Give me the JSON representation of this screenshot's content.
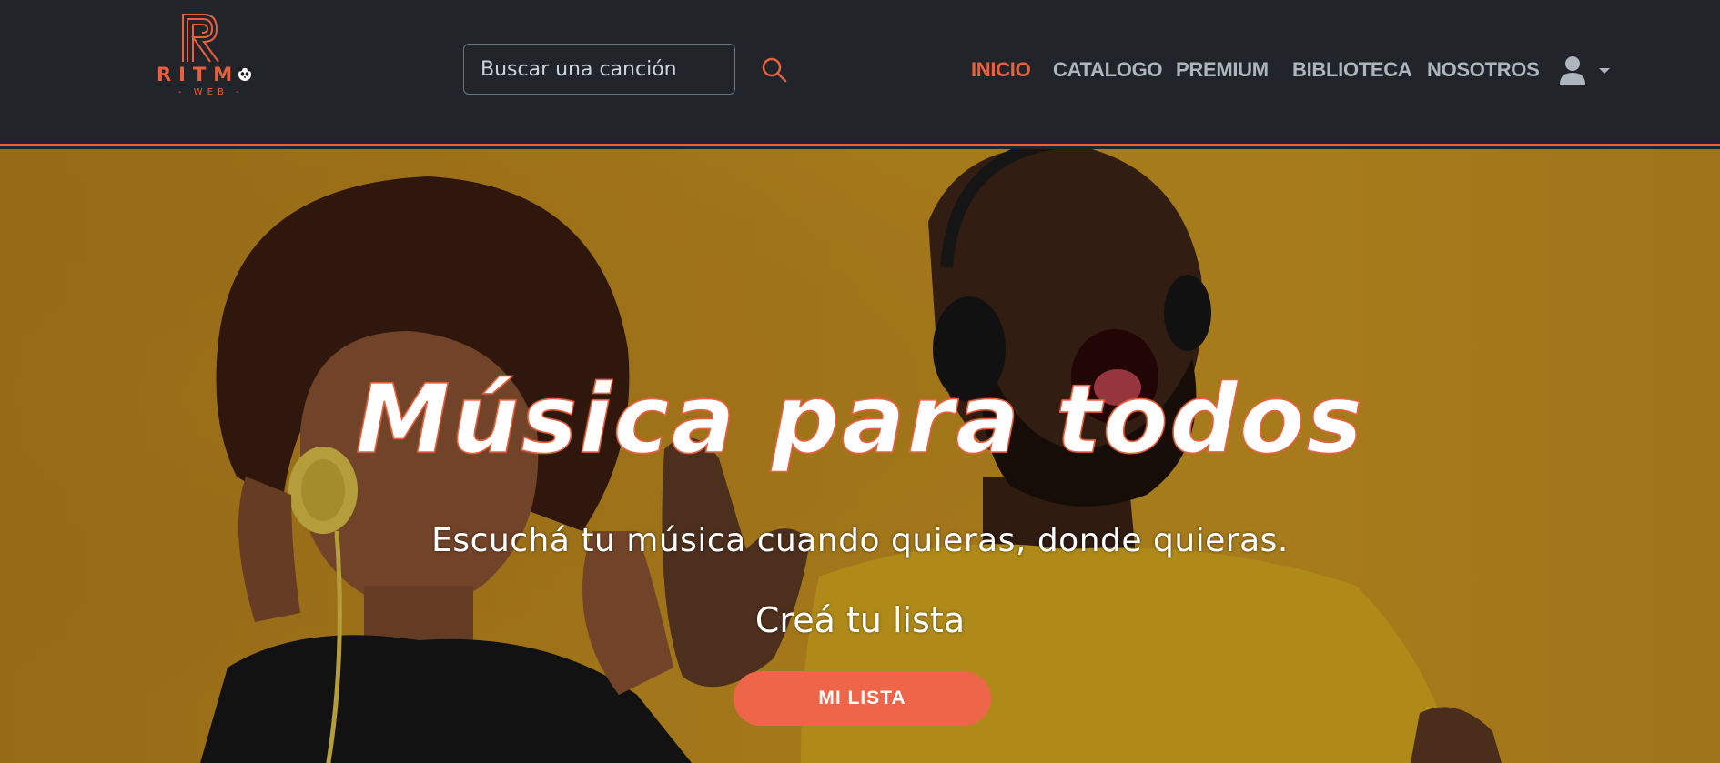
{
  "brand": {
    "logo_text": "RITM",
    "logo_sub": "- WEB -",
    "logo_icon": "panda-icon",
    "accent_color": "#e8613f"
  },
  "search": {
    "placeholder": "Buscar una canción",
    "value": "",
    "icon": "search-icon"
  },
  "nav": {
    "items": [
      {
        "label": "INICIO",
        "active": true
      },
      {
        "label": "CATALOGO",
        "active": false
      },
      {
        "label": "PREMIUM",
        "active": false
      },
      {
        "label": "BIBLIOTECA",
        "active": false
      },
      {
        "label": "NOSOTROS",
        "active": false
      }
    ],
    "user_icon": "user-icon",
    "dropdown_icon": "caret-down-icon"
  },
  "hero": {
    "title": "Música para todos",
    "subtitle": "Escuchá tu música cuando quieras, donde quieras.",
    "cta_text": "Creá tu lista",
    "button_label": "MI LISTA",
    "button_color": "#ef6549"
  }
}
